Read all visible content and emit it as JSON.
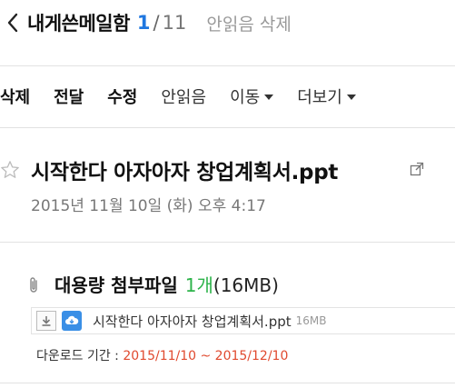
{
  "header": {
    "title": "내게쓴메일함",
    "page_current": "1",
    "page_separator": "/",
    "page_total": "11",
    "mark_unread_delete": "안읽음 삭제"
  },
  "toolbar": {
    "delete": "삭제",
    "forward": "전달",
    "edit": "수정",
    "unread": "안읽음",
    "move": "이동",
    "more": "더보기"
  },
  "mail": {
    "subject": "시작한다 아자아자 창업계획서.ppt",
    "date": "2015년 11월 10일 (화) 오후 4:17"
  },
  "attachment": {
    "title": "대용량 첨부파일",
    "count": "1개",
    "total_size": "(16MB)",
    "file_name": "시작한다 아자아자 창업계획서.ppt",
    "file_size": "16MB",
    "period_label": "다운로드 기간 : ",
    "period_range": "2015/11/10 ~ 2015/12/10"
  },
  "colors": {
    "accent_blue": "#1f77e0",
    "count_green": "#2db34a",
    "period_red": "#e04a2f"
  },
  "icons": {
    "back": "chevron-left-icon",
    "star": "star-outline-icon",
    "popout": "popout-icon",
    "clip": "paperclip-icon",
    "download": "download-icon",
    "cloud": "cloud-save-icon"
  }
}
